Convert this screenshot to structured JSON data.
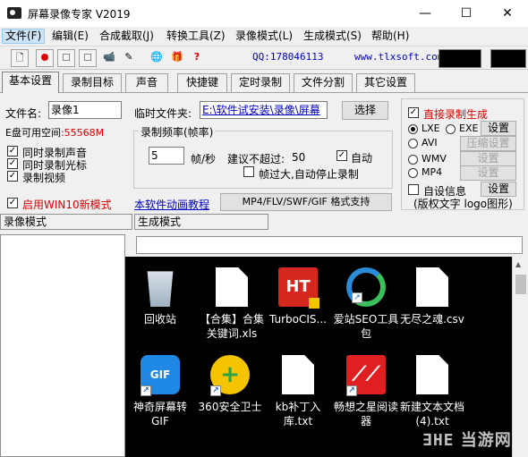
{
  "window": {
    "title": "屏幕录像专家 V2019",
    "minimize": "—",
    "maximize": "☐",
    "close": "✕"
  },
  "menu": [
    "文件(F)",
    "编辑(E)",
    "合成截取(J)",
    "转换工具(Z)",
    "录像模式(L)",
    "生成模式(S)",
    "帮助(H)"
  ],
  "toolbar": {
    "qq": "QQ:178046113",
    "url": "www.tlxsoft.com"
  },
  "tabs": [
    "基本设置",
    "录制目标",
    "声音",
    "快捷键",
    "定时录制",
    "文件分割",
    "其它设置"
  ],
  "basic": {
    "filename_label": "文件名:",
    "filename_value": "录像1",
    "tempdir_label": "临时文件夹:",
    "tempdir_value": "E:\\软件试安装\\录像\\屏幕",
    "select_button": "选择",
    "disk_label": "E盘可用空间",
    "disk_value": ":55568M",
    "chk_sound": "同时录制声音",
    "chk_cursor": "同时录制光标",
    "chk_video": "录制视频",
    "chk_win10": "启用WIN10新模式",
    "freq_title": "录制频率(帧率)",
    "fps_value": "5",
    "fps_unit": "帧/秒",
    "max_label": "建议不超过:",
    "max_value": "50",
    "auto_label": "自动",
    "auto_stop": "帧过大,自动停止录制",
    "anim_link": "本软件动画教程",
    "formats_button": "MP4/FLV/SWF/GIF  格式支持"
  },
  "right": {
    "direct_gen": "直接录制生成",
    "lxe": "LXE",
    "exe": "EXE",
    "settings": "设置",
    "avi": "AVI",
    "compress": "压缩设置",
    "wmv": "WMV",
    "mp4": "MP4",
    "self_info": "自设信息",
    "copyright": "(版权文字 logo图形)"
  },
  "panes": {
    "record_mode": "录像模式",
    "gen_mode": "生成模式"
  },
  "desktop": [
    {
      "label": "回收站"
    },
    {
      "label": "【合集】合集关键词.xls"
    },
    {
      "label": "TurboCIS..."
    },
    {
      "label": "爱站SEO工具包"
    },
    {
      "label": "无尽之魂.csv"
    },
    {
      "label": "神奇屏幕转GIF"
    },
    {
      "label": "360安全卫士"
    },
    {
      "label": "kb补丁入库.txt"
    },
    {
      "label": "畅想之星阅读器"
    },
    {
      "label": "新建文本文档(4).txt"
    }
  ],
  "watermark": "当游网"
}
